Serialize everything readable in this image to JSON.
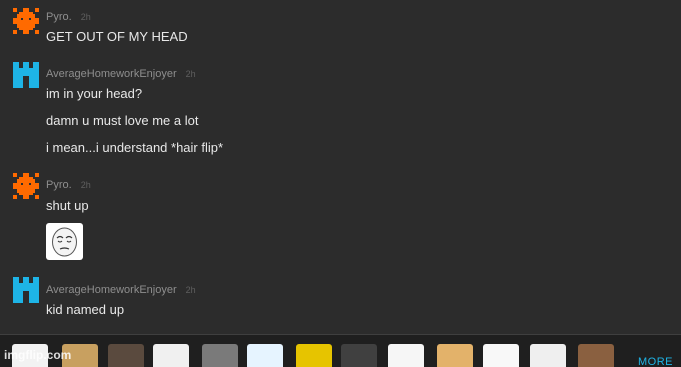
{
  "messages": [
    {
      "username": "Pyro.",
      "time": "2h",
      "avatar_icon": "orange-pixel-sun-icon",
      "avatar_color": "#ff6a00",
      "lines": [
        "GET OUT OF MY HEAD"
      ]
    },
    {
      "username": "AverageHomeworkEnjoyer",
      "time": "2h",
      "avatar_icon": "cyan-pixel-castle-icon",
      "avatar_color": "#1eb4e6",
      "lines": [
        "im in your head?",
        "damn u must love me a lot",
        "i mean...i understand *hair flip*"
      ]
    },
    {
      "username": "Pyro.",
      "time": "2h",
      "avatar_icon": "orange-pixel-sun-icon",
      "avatar_color": "#ff6a00",
      "lines": [
        "shut up"
      ],
      "image": "okay-face-meme"
    },
    {
      "username": "AverageHomeworkEnjoyer",
      "time": "2h",
      "avatar_icon": "cyan-pixel-castle-icon",
      "avatar_color": "#1eb4e6",
      "lines": [
        "kid named up"
      ]
    }
  ],
  "meme_strip": {
    "items": [
      "rage-face-meme",
      "cat-meme",
      "man-meme",
      "rage-face-meme",
      "gray-meme",
      "crying-face-meme",
      "yellow-meme",
      "sunglasses-meme",
      "rage-face-meme",
      "doge-meme",
      "rage-face-meme",
      "rage-face-meme",
      "man-meme"
    ],
    "more_label": "MORE"
  },
  "watermark": "imgflip.com"
}
